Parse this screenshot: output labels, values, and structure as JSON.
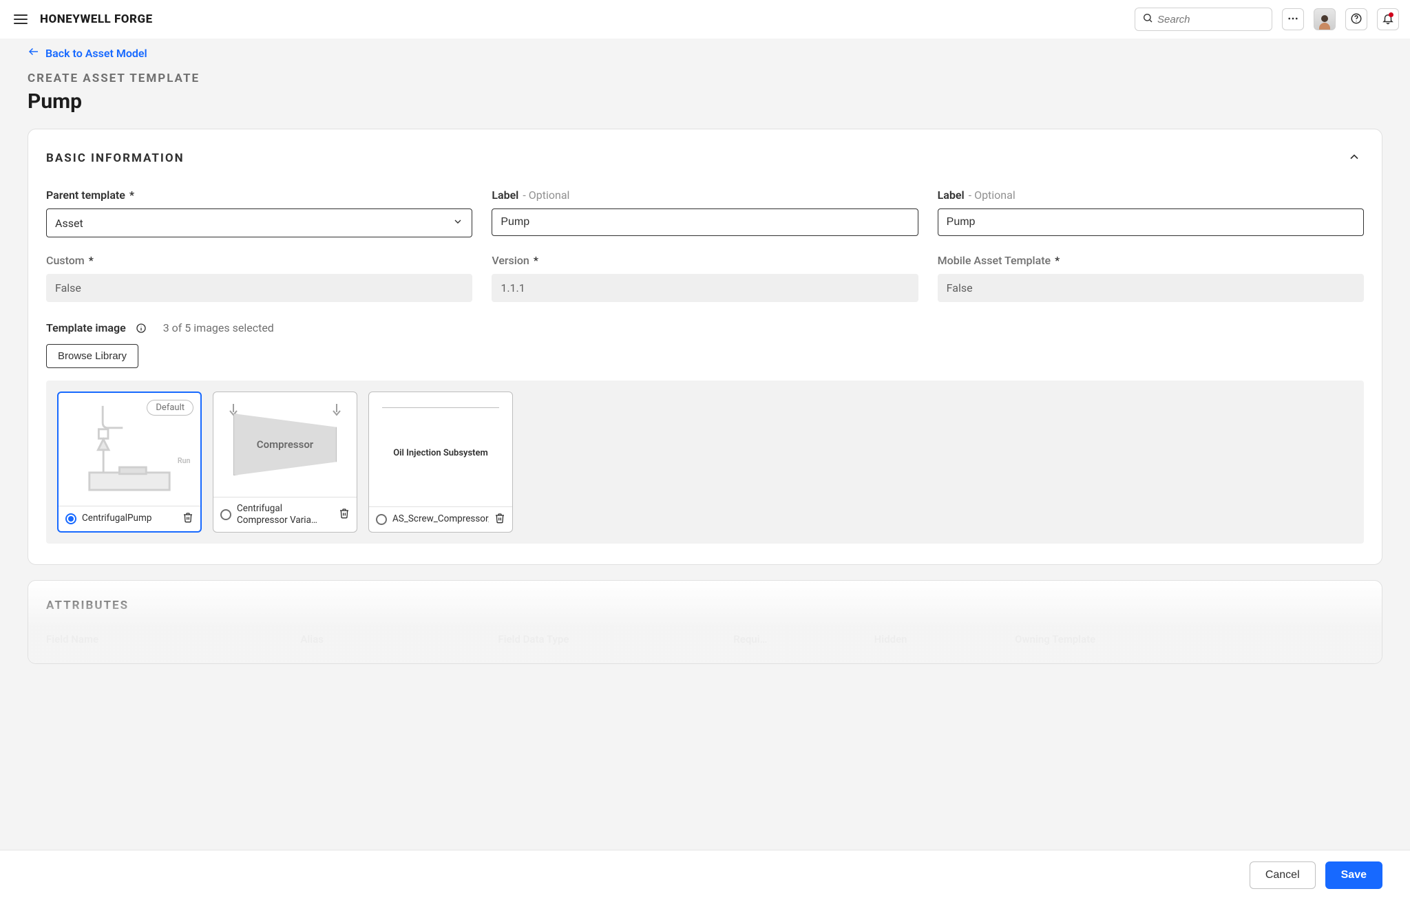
{
  "topbar": {
    "brand": "HONEYWELL FORGE",
    "search_placeholder": "Search"
  },
  "page": {
    "back_label": "Back to Asset Model",
    "eyebrow": "CREATE ASSET TEMPLATE",
    "title": "Pump"
  },
  "basic_info": {
    "section_title": "BASIC INFORMATION",
    "fields": {
      "parent_template": {
        "label": "Parent template",
        "value": "Asset"
      },
      "label1": {
        "label": "Label",
        "optional": "- Optional",
        "value": "Pump"
      },
      "label2": {
        "label": "Label",
        "optional": "- Optional",
        "value": "Pump"
      },
      "custom": {
        "label": "Custom",
        "value": "False"
      },
      "version": {
        "label": "Version",
        "value": "1.1.1"
      },
      "mobile": {
        "label": "Mobile Asset Template",
        "value": "False"
      }
    },
    "template_image": {
      "label": "Template image",
      "count_text": "3 of 5 images selected",
      "browse_label": "Browse Library",
      "default_badge": "Default",
      "images": [
        {
          "name": "CentrifugalPump",
          "selected": true,
          "is_default": true
        },
        {
          "name": "Centrifugal Compressor Varia…",
          "selected": false,
          "is_default": false,
          "preview_label": "Compressor"
        },
        {
          "name": "AS_Screw_Compressor_Oil_Injected_V…",
          "selected": false,
          "is_default": false,
          "preview_label": "Oil Injection Subsystem"
        }
      ]
    }
  },
  "attributes": {
    "section_title": "ATTRIBUTES",
    "columns": [
      "Field Name",
      "Alias",
      "Field Data Type",
      "Requi…",
      "Hidden",
      "Owning Template",
      ""
    ]
  },
  "footer": {
    "cancel": "Cancel",
    "save": "Save"
  }
}
